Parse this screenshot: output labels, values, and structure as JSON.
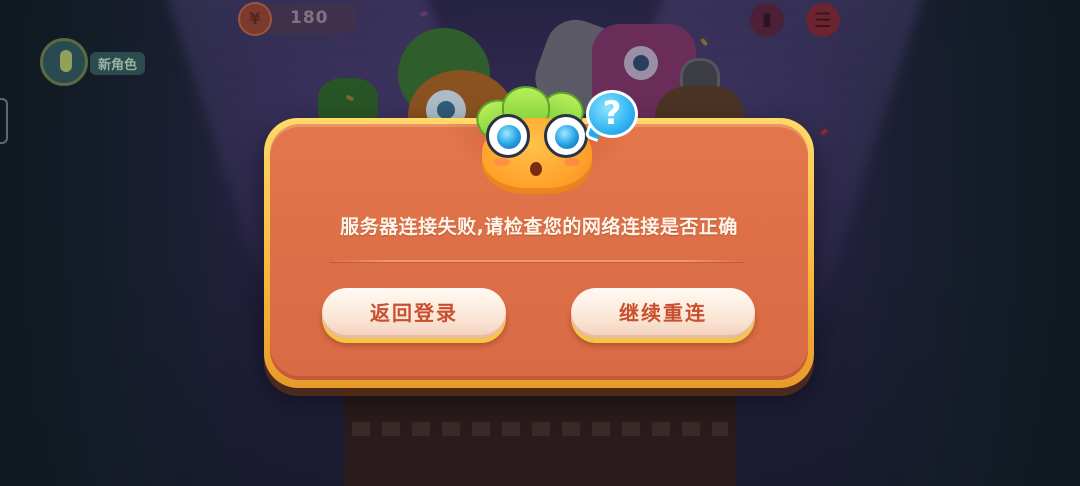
{
  "hud": {
    "coin_icon": "currency-coin-icon",
    "coin_count": "180",
    "new_role_label": "新角色",
    "menu_icon": "menu-icon"
  },
  "dialog": {
    "message": "服务器连接失败,请检查您的网络连接是否正确",
    "back_button_label": "返回登录",
    "retry_button_label": "继续重连",
    "mascot_icon": "carrot-mascot-icon",
    "question_icon": "question-bubble-icon",
    "question_glyph": "?"
  },
  "colors": {
    "dialog_fill": "#de7048",
    "dialog_border": "#f6b73a",
    "button_fill": "#fbe6d6",
    "button_text": "#c9502f",
    "message_text": "#fff6ea"
  }
}
